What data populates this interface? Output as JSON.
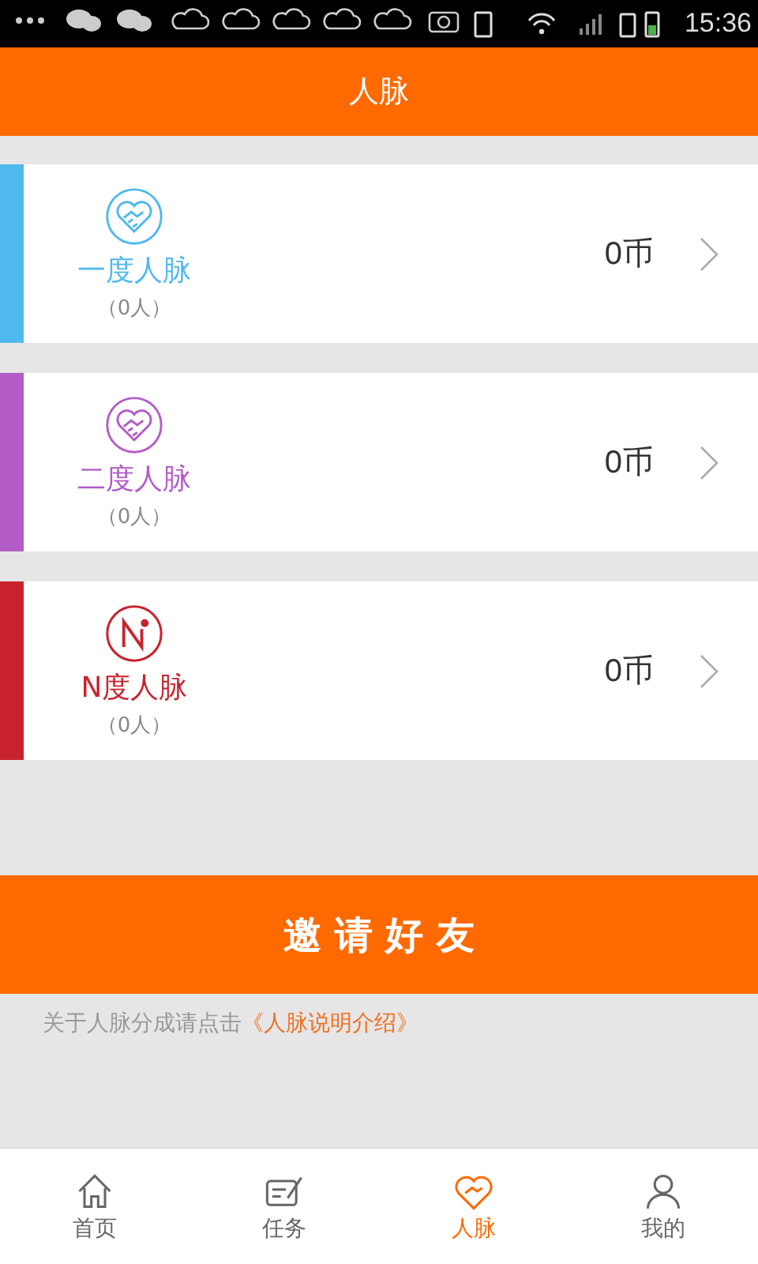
{
  "status_bar": {
    "time": "15:36"
  },
  "header": {
    "title": "人脉"
  },
  "groups": [
    {
      "kind": "heart",
      "name": "一度人脉",
      "count": "（0人）",
      "coins": "0币",
      "color": "#4fb8ee"
    },
    {
      "kind": "heart",
      "name": "二度人脉",
      "count": "（0人）",
      "coins": "0币",
      "color": "#b35cc8"
    },
    {
      "kind": "n",
      "name": "N度人脉",
      "count": "（0人）",
      "coins": "0币",
      "color": "#c8232d"
    }
  ],
  "invite_button": "邀 请 好 友",
  "note": {
    "text": "关于人脉分成请点击",
    "link": "《人脉说明介绍》"
  },
  "tabs": [
    {
      "kind": "home",
      "label": "首页",
      "selected": false
    },
    {
      "kind": "task",
      "label": "任务",
      "selected": false
    },
    {
      "kind": "heart",
      "label": "人脉",
      "selected": true
    },
    {
      "kind": "user",
      "label": "我的",
      "selected": false
    }
  ]
}
